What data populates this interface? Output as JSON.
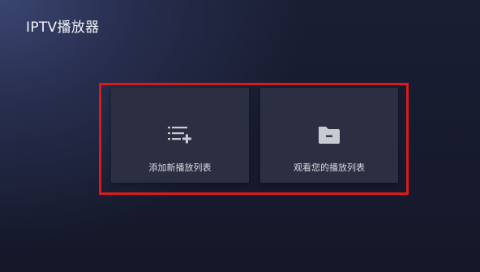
{
  "app": {
    "title": "IPTV播放器"
  },
  "menu": {
    "items": [
      {
        "label": "添加新播放列表",
        "icon": "playlist-add-icon"
      },
      {
        "label": "观看您的播放列表",
        "icon": "folder-icon"
      }
    ]
  },
  "colors": {
    "background": "#151829",
    "card": "#2b2f41",
    "highlight_border": "#d81b1b",
    "icon": "#c9cbd3"
  }
}
